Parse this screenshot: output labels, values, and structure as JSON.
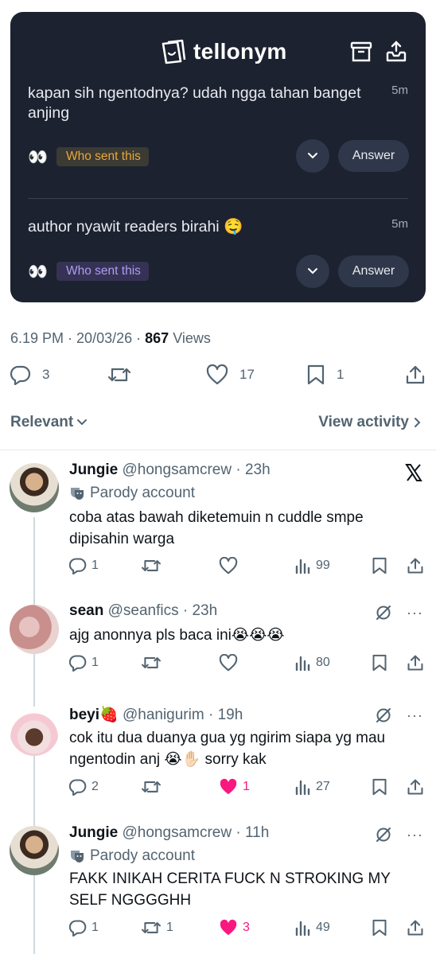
{
  "card": {
    "brand": "tellonym",
    "questions": [
      {
        "text": "kapan sih ngentodnya? udah ngga tahan banget anjing",
        "time": "5m",
        "eyes": "👀",
        "who_label": "Who sent this",
        "answer_label": "Answer"
      },
      {
        "text": "author nyawit readers birahi 🤤",
        "time": "5m",
        "eyes": "👀",
        "who_label": "Who sent this",
        "answer_label": "Answer"
      }
    ]
  },
  "meta": {
    "time": "6.19 PM",
    "date": "20/03/26",
    "views_count": "867",
    "views_label": "Views"
  },
  "actions": {
    "replies": "3",
    "likes": "17",
    "bookmarks": "1"
  },
  "sort": {
    "label": "Relevant",
    "view_activity": "View activity"
  },
  "replies": [
    {
      "name": "Jungie",
      "handle": "@hongsamcrew",
      "time": "23h",
      "parody": "Parody account",
      "text": "coba atas bawah diketemuin n cuddle smpe dipisahin warga",
      "replies": "1",
      "reposts": "",
      "likes": "",
      "views": "99",
      "liked": false
    },
    {
      "name": "sean",
      "handle": "@seanfics",
      "time": "23h",
      "text": "ajg anonnya pls baca ini😭😭😭",
      "replies": "1",
      "reposts": "",
      "likes": "",
      "views": "80",
      "liked": false
    },
    {
      "name": "beyi🍓",
      "handle": "@hanigurim",
      "time": "19h",
      "text": "cok itu dua duanya gua yg ngirim siapa yg mau ngentodin anj 😭✋🏻 sorry kak",
      "replies": "2",
      "reposts": "",
      "likes": "1",
      "views": "27",
      "liked": true
    },
    {
      "name": "Jungie",
      "handle": "@hongsamcrew",
      "time": "11h",
      "parody": "Parody account",
      "text": "FAKK INIKAH CERITA FUCK N STROKING MY SELF NGGGGHH",
      "replies": "1",
      "reposts": "1",
      "likes": "3",
      "views": "49",
      "liked": true
    }
  ],
  "colors": {
    "card_bg": "#1c2230",
    "who_orange": "#e8a73b",
    "who_purple": "#a99ef5",
    "like_pink": "#f91880",
    "muted": "#536471"
  }
}
